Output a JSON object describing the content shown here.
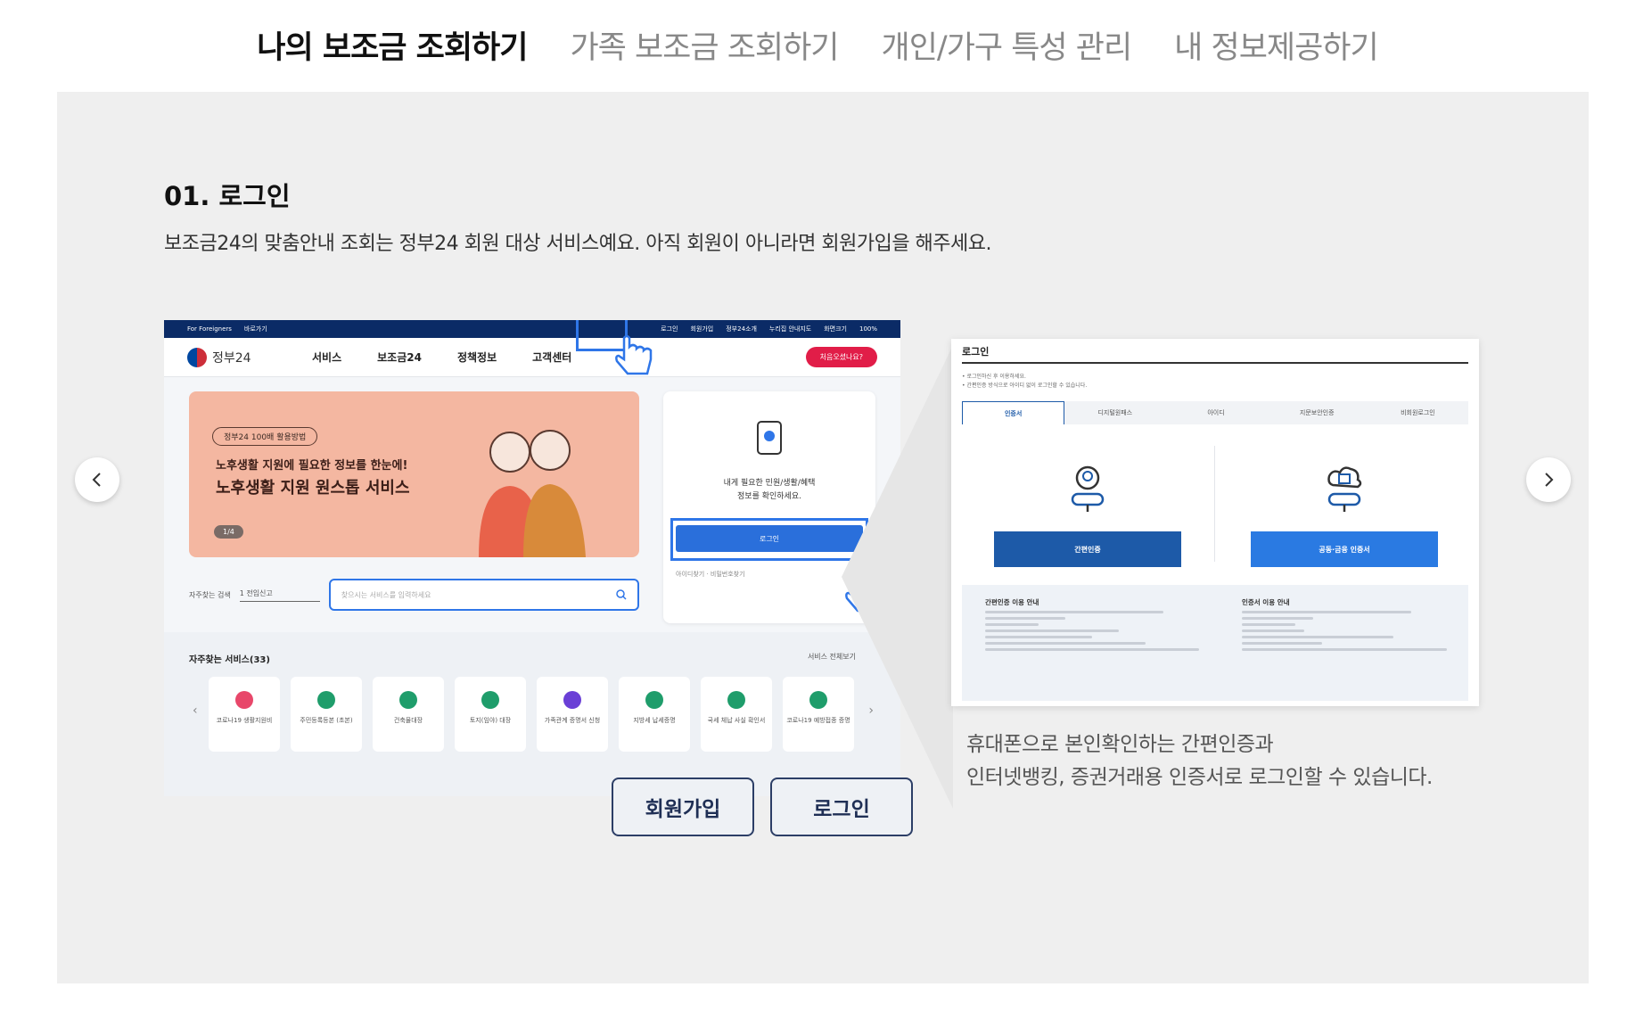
{
  "tabs": [
    {
      "label": "나의 보조금 조회하기",
      "active": true
    },
    {
      "label": "가족 보조금 조회하기",
      "active": false
    },
    {
      "label": "개인/가구 특성 관리",
      "active": false
    },
    {
      "label": "내 정보제공하기",
      "active": false
    }
  ],
  "step": {
    "title": "01. 로그인",
    "description": "보조금24의 맞춤안내 조회는 정부24 회원 대상 서비스예요. 아직 회원이 아니라면 회원가입을 해주세요."
  },
  "carousel": {
    "prev_icon": "chevron-left-icon",
    "next_icon": "chevron-right-icon"
  },
  "screenshot1": {
    "topbar_left": "For Foreigners",
    "topbar_left2": "바로가기",
    "topbar_items": [
      "로그인",
      "회원가입",
      "정부24소개",
      "누리집 안내지도",
      "화면크기",
      "100%"
    ],
    "logo": "정부24",
    "nav": [
      "서비스",
      "보조금24",
      "정책정보",
      "고객센터"
    ],
    "cta": "처음오셨나요?",
    "banner_pill": "정부24 100배 활용방법",
    "banner_line1": "노후생활 지원에 필요한 정보를 한눈에!",
    "banner_line2": "노후생활 지원 원스톱 서비스",
    "banner_pager": "1/4",
    "login_text_1": "내게 필요한 민원/생활/혜택",
    "login_text_2": "정보를 확인하세요.",
    "login_button": "로그인",
    "login_links": "아이디찾기 · 비밀번호찾기",
    "search_label": "자주찾는 검색",
    "search_select": "1 전입신고",
    "search_placeholder": "찾으시는 서비스를 입력하세요",
    "services_title": "자주찾는 서비스(33)",
    "services_all": "서비스 전체보기",
    "services": [
      {
        "label": "코로나19 생활지원비",
        "color": "#e8476a"
      },
      {
        "label": "주민등록등본 (초본)",
        "color": "#1f9d6b"
      },
      {
        "label": "건축물대장",
        "color": "#1f9d6b"
      },
      {
        "label": "토지(임야) 대장",
        "color": "#1f9d6b"
      },
      {
        "label": "가족관계 증명서 신청",
        "color": "#6a3fd6"
      },
      {
        "label": "지방세 납세증명",
        "color": "#1f9d6b"
      },
      {
        "label": "국세 체납 사실 확인서",
        "color": "#1f9d6b"
      },
      {
        "label": "코로나19 예방접종 증명",
        "color": "#1f9d6b"
      }
    ]
  },
  "screenshot2": {
    "title": "로그인",
    "note1": "• 로그인하신 후 이용하세요.",
    "note2": "• 간편인증 방식으로 아이디 없이 로그인할 수 있습니다.",
    "tabs": [
      "인증서",
      "디지털원패스",
      "아이디",
      "지문보안인증",
      "비회원로그인"
    ],
    "btn_left": "간편인증",
    "btn_right": "공동·금융 인증서",
    "info_left_title": "간편인증 이용 안내",
    "info_right_title": "인증서 이용 안내"
  },
  "caption": {
    "line1": "휴대폰으로 본인확인하는 간편인증과",
    "line2": "인터넷뱅킹, 증권거래용 인증서로 로그인할 수 있습니다."
  },
  "buttons": {
    "signup": "회원가입",
    "login": "로그인"
  },
  "colors": {
    "accent": "#2f76e8",
    "navy": "#0b2b66",
    "panel": "#efefef",
    "button_border": "#2c3e66",
    "btn_left": "#1d5aa8",
    "btn_right": "#2a7ae2"
  }
}
